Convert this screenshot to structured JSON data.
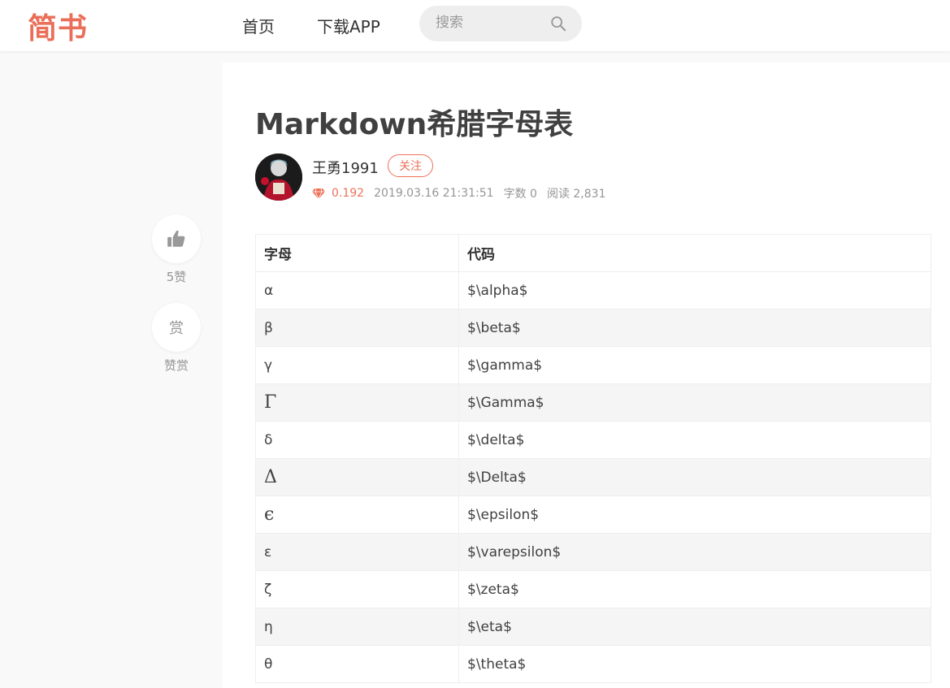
{
  "brand": {
    "logo_text": "简书",
    "color": "#ea6f5a"
  },
  "nav": {
    "home": "首页",
    "download": "下载APP"
  },
  "search": {
    "placeholder": "搜索",
    "icon": "search-icon"
  },
  "sidebar": {
    "like_count": "5赞",
    "reward_glyph": "赏",
    "reward_label": "赞赏"
  },
  "article": {
    "title": "Markdown希腊字母表",
    "author": "王勇1991",
    "follow_label": "关注",
    "diamond_score": "0.192",
    "date": "2019.03.16 21:31:51",
    "word_count": "字数 0",
    "reads": "阅读 2,831",
    "accent_color": "#ec7259"
  },
  "table": {
    "headers": [
      "字母",
      "代码"
    ],
    "rows": [
      [
        "α",
        "$\\alpha$"
      ],
      [
        "β",
        "$\\beta$"
      ],
      [
        "γ",
        "$\\gamma$"
      ],
      [
        "Γ",
        "$\\Gamma$"
      ],
      [
        "δ",
        "$\\delta$"
      ],
      [
        "Δ",
        "$\\Delta$"
      ],
      [
        "ϵ",
        "$\\epsilon$"
      ],
      [
        "ε",
        "$\\varepsilon$"
      ],
      [
        "ζ",
        "$\\zeta$"
      ],
      [
        "η",
        "$\\eta$"
      ],
      [
        "θ",
        "$\\theta$"
      ]
    ]
  }
}
